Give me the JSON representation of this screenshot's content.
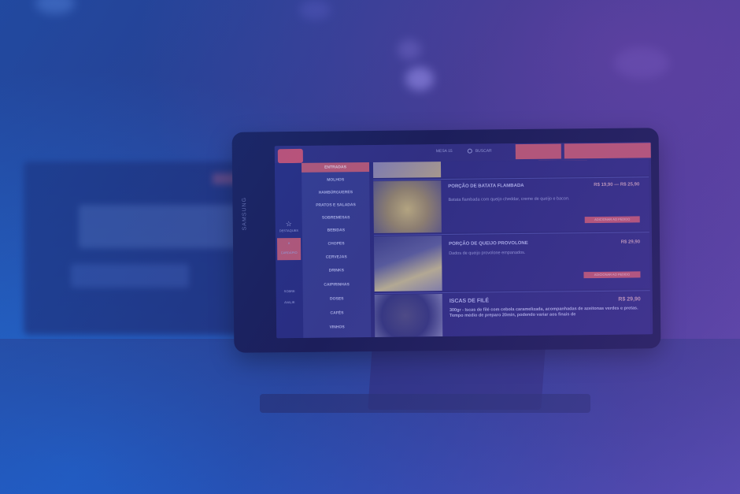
{
  "tablet": {
    "brand": "SAMSUNG",
    "header": {
      "mesa_label": "MESA 15",
      "search_label": "BUSCAR"
    },
    "sidebar": {
      "items": [
        {
          "label": "DESTAQUES"
        },
        {
          "label": "CARDÁPIO"
        },
        {
          "label": "SOBRE"
        },
        {
          "label": "AVALIE"
        }
      ]
    },
    "menu": {
      "items": [
        "ENTRADAS",
        "MOLHOS",
        "HAMBÚRGUERES",
        "PRATOS E SALADAS",
        "SOBREMESAS",
        "BEBIDAS",
        "CHOPES",
        "CERVEJAS",
        "DRINKS",
        "CAIPIRINHAS",
        "DOSES",
        "CAFÉS",
        "VINHOS"
      ]
    },
    "dishes": [
      {
        "title": "PORÇÃO DE BATATA FLAMBADA",
        "price": "R$ 19,90 — R$ 25,90",
        "description": "Batata flambada com queijo cheddar, creme de queijo e bacon.",
        "button": "ADICIONAR AO PEDIDO"
      },
      {
        "title": "PORÇÃO DE QUEIJO PROVOLONE",
        "price": "R$ 29,90",
        "description": "Dados de queijo provolone empanados.",
        "button": "ADICIONAR AO PEDIDO"
      },
      {
        "title": "ISCAS DE FILÉ",
        "price": "R$ 29,90",
        "description": "300gr - Iscas de filé com cebola caramelizada, acompanhadas de azeitonas verdes e pretas. Tempo médio de preparo 20min, podendo variar aos finais de"
      }
    ]
  }
}
